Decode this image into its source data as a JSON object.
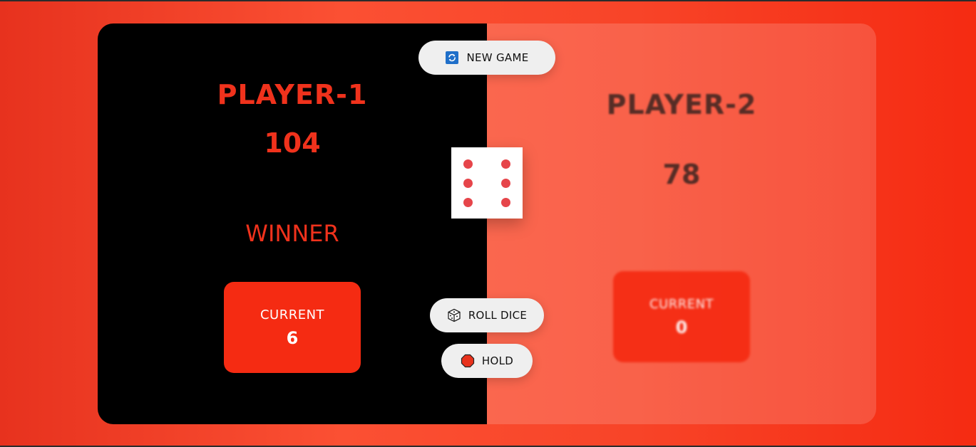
{
  "players": [
    {
      "name": "PLAYER-1",
      "score": "104",
      "status": "WINNER",
      "current_label": "CURRENT",
      "current_value": "6",
      "active": true
    },
    {
      "name": "PLAYER-2",
      "score": "78",
      "current_label": "CURRENT",
      "current_value": "0",
      "active": false
    }
  ],
  "controls": {
    "new_game": {
      "label": "NEW GAME",
      "icon": "refresh-icon"
    },
    "roll_dice": {
      "label": "ROLL DICE",
      "icon": "dice-icon"
    },
    "hold": {
      "label": "HOLD",
      "icon": "stop-icon"
    }
  },
  "dice": {
    "value": 6,
    "pip_color": "#e6454a"
  },
  "colors": {
    "accent": "#f0321c",
    "current_box": "#f52b12",
    "active_panel": "#000000",
    "button_bg": "#efefef"
  }
}
